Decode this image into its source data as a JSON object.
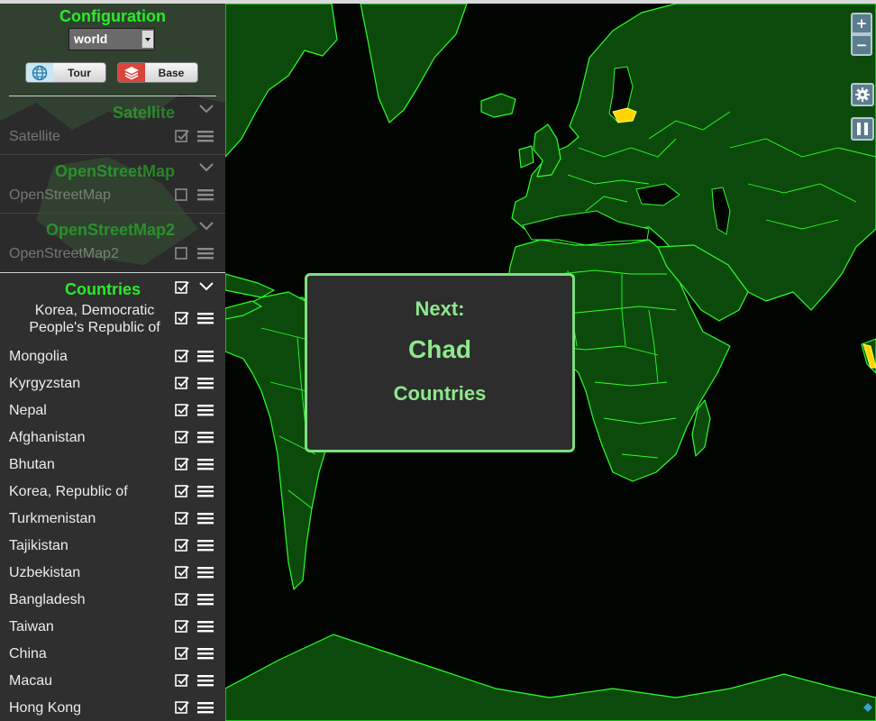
{
  "sidebar": {
    "config_title": "Configuration",
    "config_select": {
      "selected": "world"
    },
    "buttons": {
      "tour_label": "Tour",
      "base_label": "Base"
    },
    "layers": [
      {
        "title": "Satellite",
        "row_label": "Satellite",
        "checked": true
      },
      {
        "title": "OpenStreetMap",
        "row_label": "OpenStreetMap",
        "checked": false
      },
      {
        "title": "OpenStreetMap2",
        "row_label": "OpenStreetMap2",
        "checked": false
      }
    ],
    "countries_title": "Countries",
    "countries": [
      "Korea, Democratic People's Republic of",
      "Mongolia",
      "Kyrgyzstan",
      "Nepal",
      "Afghanistan",
      "Bhutan",
      "Korea, Republic of",
      "Turkmenistan",
      "Tajikistan",
      "Uzbekistan",
      "Bangladesh",
      "Taiwan",
      "China",
      "Macau",
      "Hong Kong"
    ]
  },
  "map_controls": {
    "zoom_in": "+",
    "zoom_out": "−"
  },
  "popup": {
    "heading": "Next:",
    "country": "Chad",
    "layer": "Countries"
  },
  "colors": {
    "accent_green": "#26ee26",
    "land": "#0b4a0b",
    "border": "#2bff2b",
    "highlight": "#ffd400",
    "popup_text": "#8de98d"
  },
  "icons": [
    "globe-icon",
    "layers-icon",
    "checkbox-checked-icon",
    "checkbox-empty-icon",
    "drag-menu-icon",
    "chevron-down-icon",
    "gear-icon",
    "pause-icon"
  ]
}
